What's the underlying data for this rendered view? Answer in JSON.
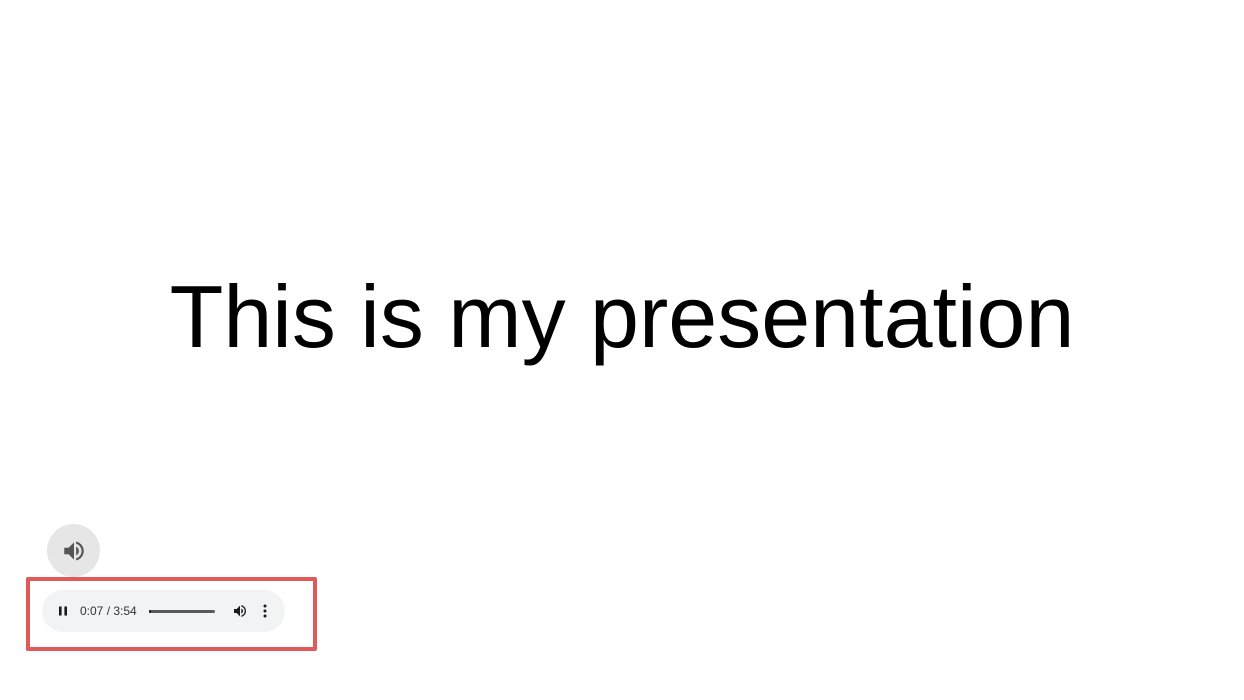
{
  "slide": {
    "title": "This is my presentation"
  },
  "audio_icon": {
    "icon": "speaker-icon"
  },
  "player": {
    "state": "playing",
    "play_pause_icon": "pause-icon",
    "time_display": "0:07 / 3:54",
    "current_time": "0:07",
    "duration": "3:54",
    "progress_fraction": 0.03,
    "volume_icon": "volume-icon",
    "menu_icon": "more-vertical-icon"
  },
  "colors": {
    "highlight_border": "#e05a5a",
    "player_background": "#f1f3f4",
    "icon_button_background": "#e6e6e6"
  }
}
